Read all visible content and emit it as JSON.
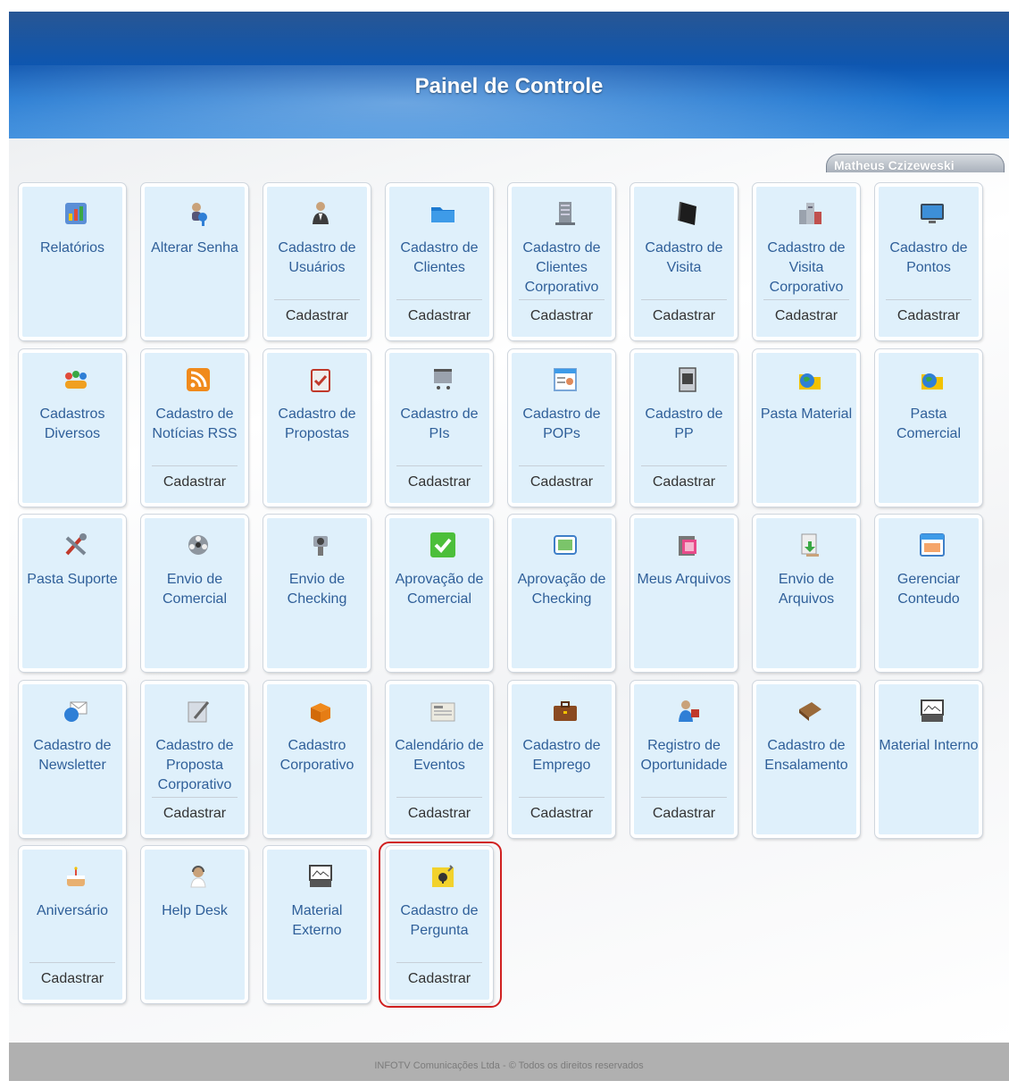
{
  "header": {
    "title": "Painel de Controle"
  },
  "user": {
    "name": "Matheus Czizeweski"
  },
  "action_label": "Cadastrar",
  "footer": {
    "text": "INFOTV Comunicações Ltda - © Todos os direitos reservados"
  },
  "highlight_tile": "cadastro-de-pergunta",
  "tiles": [
    {
      "id": "relatorios",
      "label": "Relatórios",
      "icon": "report-chart-icon",
      "action": false
    },
    {
      "id": "alterar-senha",
      "label": "Alterar Senha",
      "icon": "key-user-icon",
      "action": false
    },
    {
      "id": "cadastro-de-usuarios",
      "label": "Cadastro de Usuários",
      "icon": "user-suit-icon",
      "action": true
    },
    {
      "id": "cadastro-de-clientes",
      "label": "Cadastro de Clientes",
      "icon": "blue-folder-icon",
      "action": true
    },
    {
      "id": "cadastro-de-clientes-corporativo",
      "label": "Cadastro de Clientes Corporativo",
      "icon": "office-building-icon",
      "action": true
    },
    {
      "id": "cadastro-de-visita",
      "label": "Cadastro de Visita",
      "icon": "black-book-icon",
      "action": true
    },
    {
      "id": "cadastro-de-visita-corporativo",
      "label": "Cadastro de Visita Corporativo",
      "icon": "city-buildings-icon",
      "action": true
    },
    {
      "id": "cadastro-de-pontos",
      "label": "Cadastro de Pontos",
      "icon": "monitor-screen-icon",
      "action": true
    },
    {
      "id": "cadastros-diversos",
      "label": "Cadastros Diversos",
      "icon": "people-group-icon",
      "action": false
    },
    {
      "id": "cadastro-de-noticias-rss",
      "label": "Cadastro de Notícias RSS",
      "icon": "rss-feed-icon",
      "action": true
    },
    {
      "id": "cadastro-de-propostas",
      "label": "Cadastro de Propostas",
      "icon": "clipboard-check-icon",
      "action": false
    },
    {
      "id": "cadastro-de-pis",
      "label": "Cadastro de PIs",
      "icon": "shopping-cart-icon",
      "action": true
    },
    {
      "id": "cadastro-de-pops",
      "label": "Cadastro de POPs",
      "icon": "form-person-icon",
      "action": true
    },
    {
      "id": "cadastro-de-pp",
      "label": "Cadastro de PP",
      "icon": "document-image-icon",
      "action": true
    },
    {
      "id": "pasta-material",
      "label": "Pasta Material",
      "icon": "globe-folder-icon",
      "action": false
    },
    {
      "id": "pasta-comercial",
      "label": "Pasta Comercial",
      "icon": "globe-folder-icon",
      "action": false
    },
    {
      "id": "pasta-suporte",
      "label": "Pasta Suporte",
      "icon": "tools-icon",
      "action": false
    },
    {
      "id": "envio-de-comercial",
      "label": "Envio de Comercial",
      "icon": "film-reel-icon",
      "action": false
    },
    {
      "id": "envio-de-checking",
      "label": "Envio de Checking",
      "icon": "camera-icon",
      "action": false
    },
    {
      "id": "aprovacao-de-comercial",
      "label": "Aprovação de Comercial",
      "icon": "green-check-icon",
      "action": false
    },
    {
      "id": "aprovacao-de-checking",
      "label": "Aprovação de Checking",
      "icon": "picture-frame-icon",
      "action": false
    },
    {
      "id": "meus-arquivos",
      "label": "Meus Arquivos",
      "icon": "media-files-icon",
      "action": false
    },
    {
      "id": "envio-de-arquivos",
      "label": "Envio de Arquivos",
      "icon": "file-upload-icon",
      "action": false
    },
    {
      "id": "gerenciar-conteudo",
      "label": "Gerenciar Conteudo",
      "icon": "window-content-icon",
      "action": false
    },
    {
      "id": "cadastro-de-newsletter",
      "label": "Cadastro de Newsletter",
      "icon": "globe-mail-icon",
      "action": false
    },
    {
      "id": "cadastro-de-proposta-corporativo",
      "label": "Cadastro de Proposta Corporativo",
      "icon": "pen-paper-icon",
      "action": true
    },
    {
      "id": "cadastro-corporativo",
      "label": "Cadastro Corporativo",
      "icon": "open-box-icon",
      "action": false
    },
    {
      "id": "calendario-de-eventos",
      "label": "Calendário de Eventos",
      "icon": "newspaper-icon",
      "action": true
    },
    {
      "id": "cadastro-de-emprego",
      "label": "Cadastro de Emprego",
      "icon": "briefcase-icon",
      "action": true
    },
    {
      "id": "registro-de-oportunidade",
      "label": "Registro de Oportunidade",
      "icon": "business-person-icon",
      "action": true
    },
    {
      "id": "cadastro-de-ensalamento",
      "label": "Cadastro de Ensalamento",
      "icon": "brown-book-icon",
      "action": false
    },
    {
      "id": "material-interno",
      "label": "Material Interno",
      "icon": "presentation-board-icon",
      "action": false
    },
    {
      "id": "aniversario",
      "label": "Aniversário",
      "icon": "birthday-cake-icon",
      "action": true
    },
    {
      "id": "help-desk",
      "label": "Help Desk",
      "icon": "support-person-icon",
      "action": false
    },
    {
      "id": "material-externo",
      "label": "Material Externo",
      "icon": "presentation-board-icon",
      "action": false
    },
    {
      "id": "cadastro-de-pergunta",
      "label": "Cadastro de Pergunta",
      "icon": "question-note-icon",
      "action": true
    }
  ]
}
